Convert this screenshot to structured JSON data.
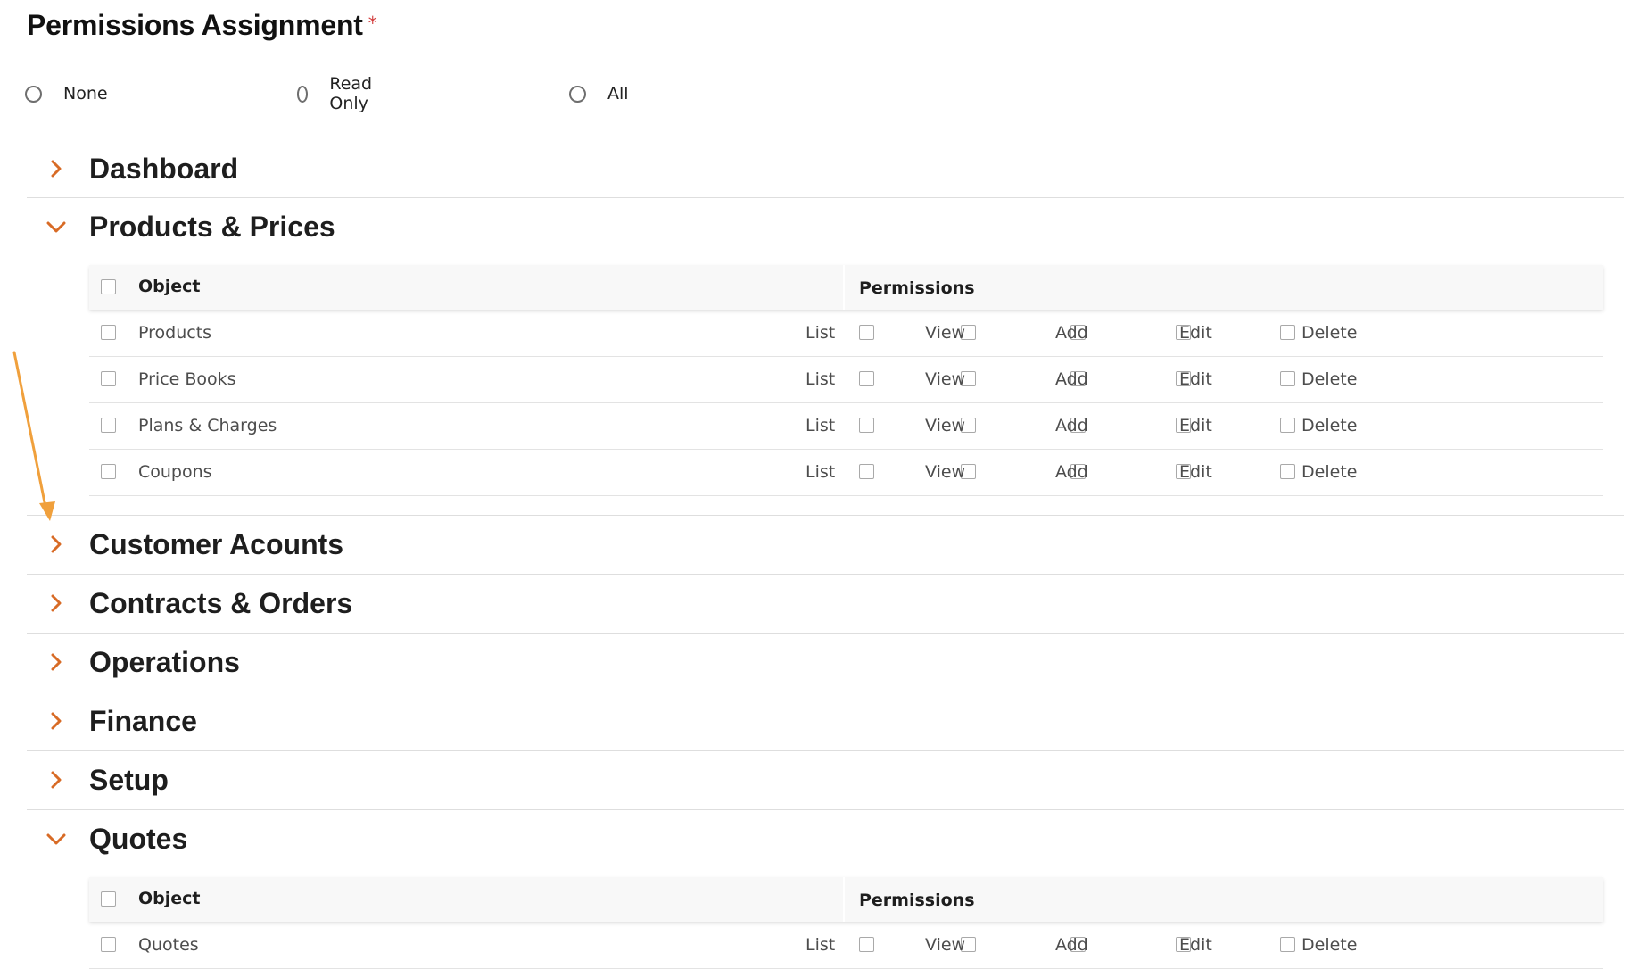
{
  "header": {
    "title": "Permissions Assignment",
    "required_mark": "*"
  },
  "radio_options": [
    {
      "label": "None",
      "selected": false
    },
    {
      "label": "Read Only",
      "selected": false
    },
    {
      "label": "All",
      "selected": false
    }
  ],
  "sections": [
    {
      "title": "Dashboard",
      "expanded": false
    },
    {
      "title": "Products & Prices",
      "expanded": true
    },
    {
      "title": "Customer Acounts",
      "expanded": false
    },
    {
      "title": "Contracts & Orders",
      "expanded": false
    },
    {
      "title": "Operations",
      "expanded": false
    },
    {
      "title": "Finance",
      "expanded": false
    },
    {
      "title": "Setup",
      "expanded": false
    },
    {
      "title": "Quotes",
      "expanded": true
    }
  ],
  "table_headers": {
    "object": "Object",
    "permissions": "Permissions"
  },
  "permission_labels": [
    "List",
    "View",
    "Add",
    "Edit",
    "Delete"
  ],
  "products_rows": [
    "Products",
    "Price Books",
    "Plans & Charges",
    "Coupons"
  ],
  "quotes_rows": [
    "Quotes"
  ],
  "colors": {
    "accent": "#d86b26",
    "arrow": "#f0a03c"
  },
  "icons": {
    "collapsed": "chevron-right-icon",
    "expanded": "chevron-down-icon",
    "annotation": "arrow-annotation"
  }
}
